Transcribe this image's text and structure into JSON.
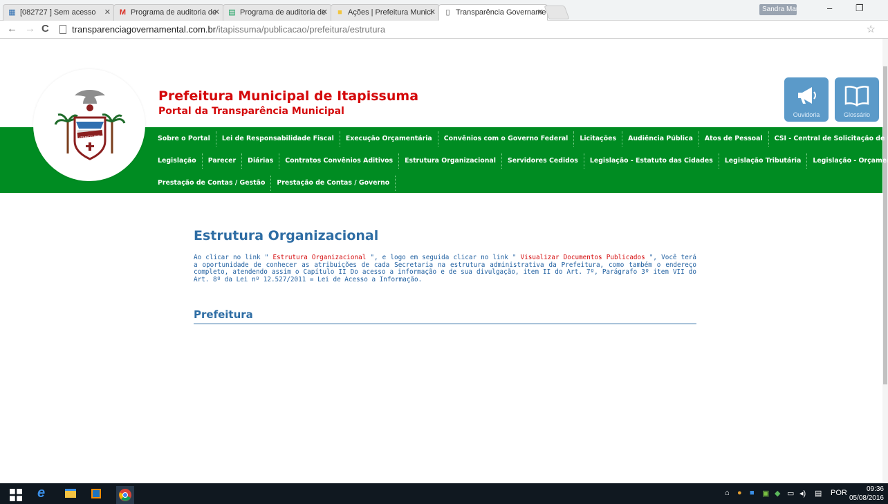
{
  "browser": {
    "tabs": [
      {
        "title": "[082727 ] Sem acesso",
        "icon": "grid-icon"
      },
      {
        "title": "Programa de auditoria de",
        "icon": "gmail-icon"
      },
      {
        "title": "Programa de auditoria de",
        "icon": "sheets-icon"
      },
      {
        "title": "Ações | Prefeitura Munici",
        "icon": "folder-icon"
      },
      {
        "title": "Transparência Govername",
        "icon": "page-icon"
      }
    ],
    "user": "Sandra Maria B...",
    "url_host": "transparenciagovernamental.com.br",
    "url_path": "/itapissuma/publicacao/prefeitura/estrutura"
  },
  "header": {
    "title": "Prefeitura Municipal de Itapissuma",
    "subtitle": "Portal da Transparência Municipal",
    "crest_text": "ITAPISSUMA",
    "ouvidoria_label": "Ouvidoria",
    "glossario_label": "Glossário"
  },
  "menu": {
    "row1": [
      "Sobre o Portal",
      "Lei de Responsabilidade Fiscal",
      "Execução Orçamentária",
      "Convênios com o Governo Federal",
      "Licitações",
      "Audiência Pública",
      "Atos de Pessoal",
      "CSI - Central de Solicitação de Informação"
    ],
    "row2": [
      "Legislação",
      "Parecer",
      "Diárias",
      "Contratos Convênios Aditivos",
      "Estrutura Organizacional",
      "Servidores Cedidos",
      "Legislação - Estatuto das Cidades",
      "Legislação Tributária",
      "Legislação - Orçamento"
    ],
    "row3": [
      "Prestação de Contas / Gestão",
      "Prestação de Contas / Governo"
    ]
  },
  "main": {
    "title": "Estrutura Organizacional",
    "intro_1": "Ao clicar  no link  \" ",
    "intro_link1": "Estrutura Organizacional",
    "intro_2": " \", e logo em  seguida  clicar no link \" ",
    "intro_link2": "Visualizar Documentos Publicados",
    "intro_3": " \", Você terá a oportunidade de conhecer  as atribuições de cada Secretaria  na  estrutura  administrativa  da  Prefeitura,  como  também  o  endereço completo, atendendo assim o Capítulo II Do acesso a informação e de sua divulgação, item II do Art. 7º, Parágrafo 3º item VII do Art. 8º da Lei nº 12.527/2011 = Lei de Acesso a Informação.",
    "subsection": "Prefeitura"
  },
  "taskbar": {
    "language": "POR",
    "time": "09:36",
    "date": "05/08/2016"
  },
  "colors": {
    "brand_red": "#d4090b",
    "menu_green": "#008c22",
    "link_blue": "#2e6da4",
    "button_blue": "#5b9ac9"
  }
}
